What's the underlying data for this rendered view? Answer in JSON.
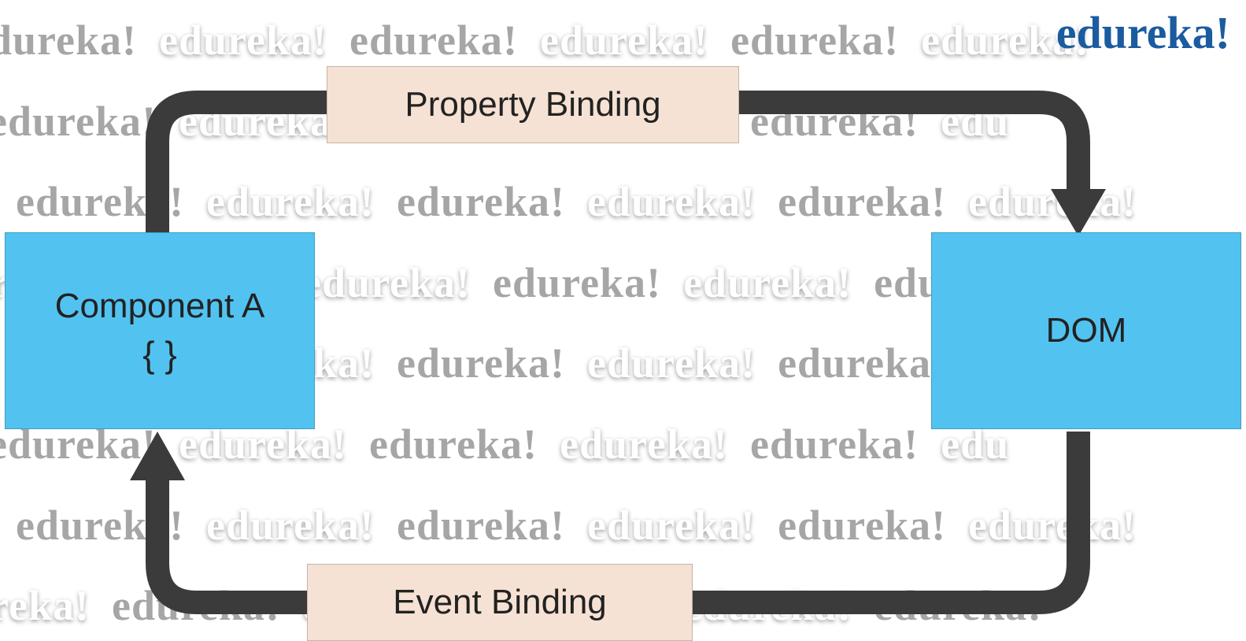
{
  "watermark": "edureka!",
  "brand": "edureka!",
  "diagram": {
    "componentBox": {
      "title": "Component A",
      "braces": "{ }"
    },
    "domBox": {
      "title": "DOM"
    },
    "propertyBinding": "Property Binding",
    "eventBinding": "Event Binding"
  },
  "colors": {
    "boxBlue": "#52c3f1",
    "boxBeige": "#f6e2d4",
    "arrow": "#3b3b3b",
    "brand": "#1b5ba0"
  }
}
